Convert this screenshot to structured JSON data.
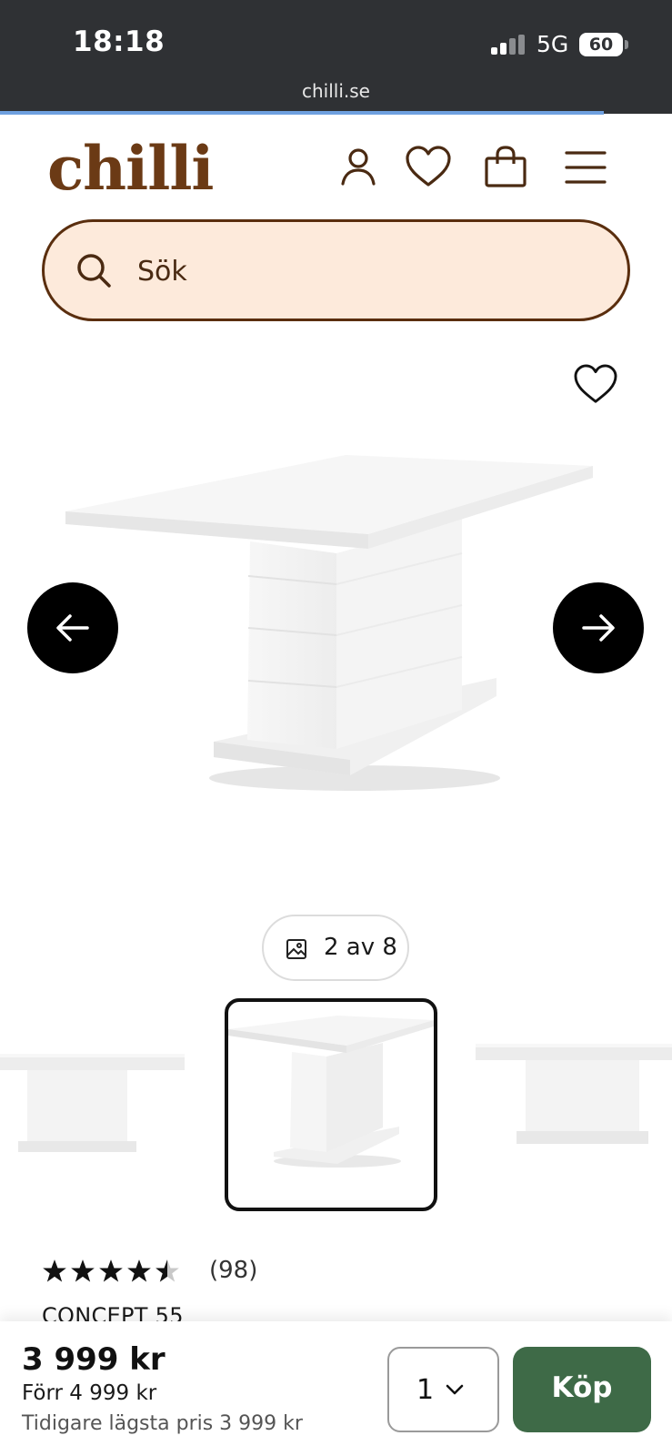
{
  "status_bar": {
    "time": "18:18",
    "network": "5G",
    "battery": "60",
    "url": "chilli.se"
  },
  "header": {
    "logo": "chilli",
    "brand_color": "#6b3a15",
    "icons": [
      "user-icon",
      "heart-icon",
      "shopping-bag-icon",
      "menu-icon"
    ]
  },
  "search": {
    "placeholder": "Sök",
    "background": "#fdeadb"
  },
  "gallery": {
    "current": 2,
    "total": 8,
    "counter_text": "2 av 8"
  },
  "product": {
    "rating": 4.5,
    "rating_max": 5,
    "review_count": "(98)",
    "name": "CONCEPT 55"
  },
  "buy_bar": {
    "price": "3 999 kr",
    "previous_price": "Förr 4 999 kr",
    "lowest_price": "Tidigare lägsta pris 3 999 kr",
    "quantity": "1",
    "buy_label": "Köp",
    "buy_color": "#3e6a47"
  }
}
